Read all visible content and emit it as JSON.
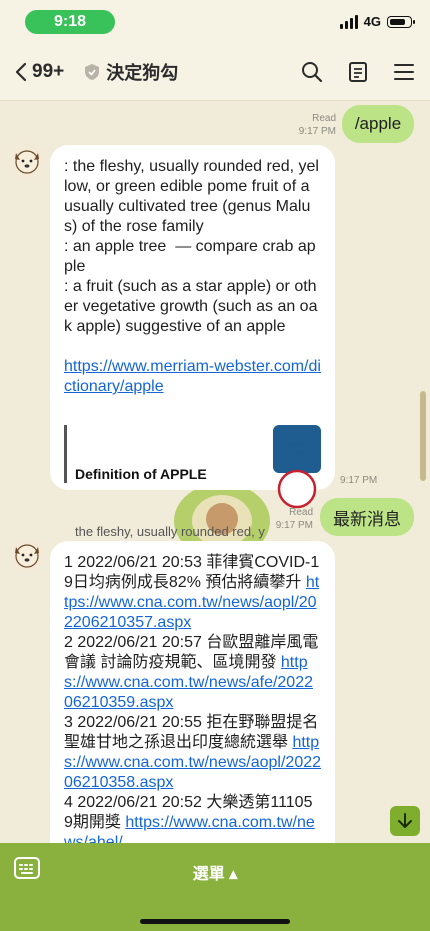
{
  "status": {
    "time": "9:18",
    "network": "4G",
    "battery_level": 0.8
  },
  "header": {
    "back_label": "99+",
    "title": "決定狗勾"
  },
  "messages": {
    "out1": {
      "text": "/apple",
      "read": "Read",
      "time": "9:17 PM"
    },
    "in1": {
      "text": ": the fleshy, usually rounded red, yellow, or green edible pome fruit of a usually cultivated tree (genus Malus) of the rose family\n: an apple tree  — compare crab apple\n: a fruit (such as a star apple) or other vegetative growth (such as an oak apple) suggestive of an apple\n\n",
      "link": "https://www.merriam-webster.com/dictionary/apple",
      "preview_title": "Definition of APPLE",
      "preview_desc": "the fleshy, usually rounded red, yellow, or green edible...",
      "preview_logo": "Merriam-Webster",
      "time": "9:17 PM"
    },
    "out2": {
      "text": "最新消息",
      "read": "Read",
      "time": "9:17 PM"
    },
    "in2": {
      "items": [
        {
          "text": "1 2022/06/21 20:53 菲律賓COVID-19日均病例成長82% 預估將續攀升 ",
          "link": "https://www.cna.com.tw/news/aopl/202206210357.aspx"
        },
        {
          "text": "2 2022/06/21 20:57 台歐盟離岸風電會議 討論防疫規範、區境開發 ",
          "link": "https://www.cna.com.tw/news/afe/202206210359.aspx"
        },
        {
          "text": "3 2022/06/21 20:55 拒在野聯盟提名 聖雄甘地之孫退出印度總統選舉 ",
          "link": "https://www.cna.com.tw/news/aopl/202206210358.aspx"
        },
        {
          "text": "4 2022/06/21 20:52 大樂透第111059期開獎 ",
          "link": "https://www.cna.com.tw/news/ahel/"
        }
      ]
    }
  },
  "bottom": {
    "menu_label": "選單 ▴"
  }
}
